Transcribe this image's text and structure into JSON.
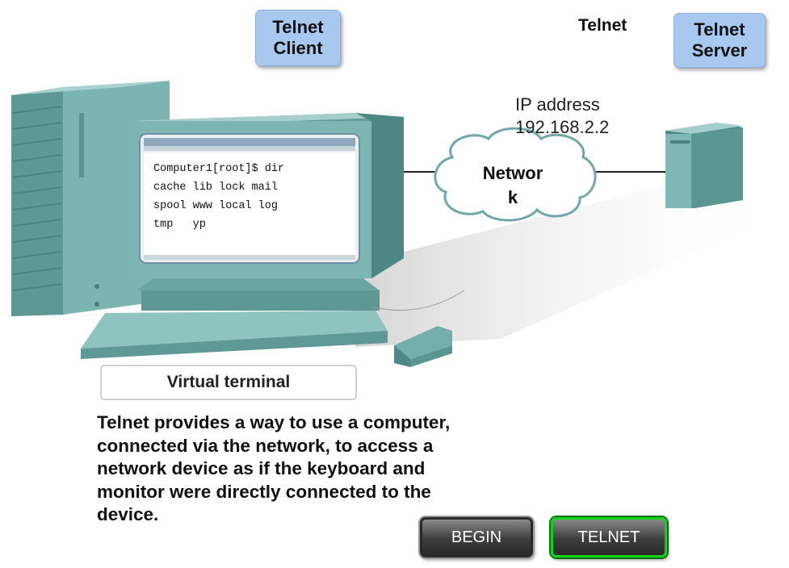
{
  "labels": {
    "telnet_client": [
      "Telnet",
      "Client"
    ],
    "telnet_text": "Telnet",
    "telnet_server": [
      "Telnet",
      "Server"
    ],
    "ip_address": [
      "IP address",
      "192.168.2.2"
    ],
    "network": [
      "Networ",
      "k"
    ]
  },
  "terminal": {
    "lines": [
      "Computer1[root]$ dir",
      "cache lib lock mail",
      "spool www local log",
      "tmp   yp"
    ]
  },
  "virtual_terminal_label": "Virtual terminal",
  "description": [
    "Telnet provides a way to use a computer,",
    "connected via the network, to access a",
    "network device as if the keyboard and",
    "monitor were directly connected to the",
    "device."
  ],
  "buttons": {
    "begin": "BEGIN",
    "telnet": "TELNET"
  },
  "colors": {
    "label_blue": "#a9c8ef",
    "device_teal": "#6fa8a6",
    "active_green": "#11d11b"
  }
}
